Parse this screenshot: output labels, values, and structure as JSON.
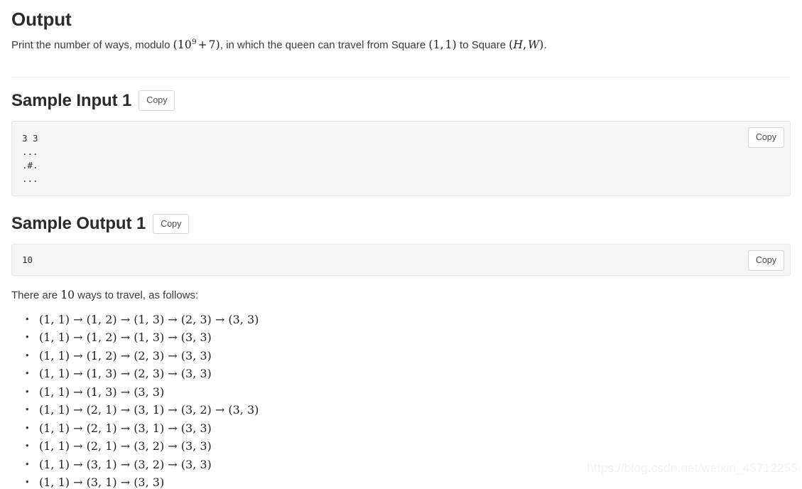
{
  "output_section": {
    "title": "Output",
    "description_prefix": "Print the number of ways, modulo ",
    "description_math_modulo": "(10⁹ + 7)",
    "description_middle": ", in which the queen can travel from Square ",
    "description_math_start": "(1, 1)",
    "description_join": " to Square ",
    "description_math_end": "(H, W)",
    "description_suffix": "."
  },
  "sample_input": {
    "heading": "Sample Input 1",
    "copy_label": "Copy",
    "block_copy_label": "Copy",
    "content": "3 3\n...\n.#.\n..."
  },
  "sample_output": {
    "heading": "Sample Output 1",
    "copy_label": "Copy",
    "block_copy_label": "Copy",
    "content": "10"
  },
  "explanation": {
    "prefix": "There are ",
    "count": "10",
    "suffix": " ways to travel, as follows:",
    "paths": [
      "(1, 1) → (1, 2) → (1, 3) → (2, 3) → (3, 3)",
      "(1, 1) → (1, 2) → (1, 3) → (3, 3)",
      "(1, 1) → (1, 2) → (2, 3) → (3, 3)",
      "(1, 1) → (1, 3) → (2, 3) → (3, 3)",
      "(1, 1) → (1, 3) → (3, 3)",
      "(1, 1) → (2, 1) → (3, 1) → (3, 2) → (3, 3)",
      "(1, 1) → (2, 1) → (3, 1) → (3, 3)",
      "(1, 1) → (2, 1) → (3, 2) → (3, 3)",
      "(1, 1) → (3, 1) → (3, 2) → (3, 3)",
      "(1, 1) → (3, 1) → (3, 3)"
    ]
  },
  "watermark": {
    "text": "https://blog.csdn.net/weixin_45712255"
  },
  "colors": {
    "heading": "#2b2b2b",
    "body_text": "#3b3b3b",
    "code_bg": "#f6f6f6",
    "code_border": "#e6e6e6",
    "divider": "#ececec",
    "watermark": "#f2f2f2"
  }
}
